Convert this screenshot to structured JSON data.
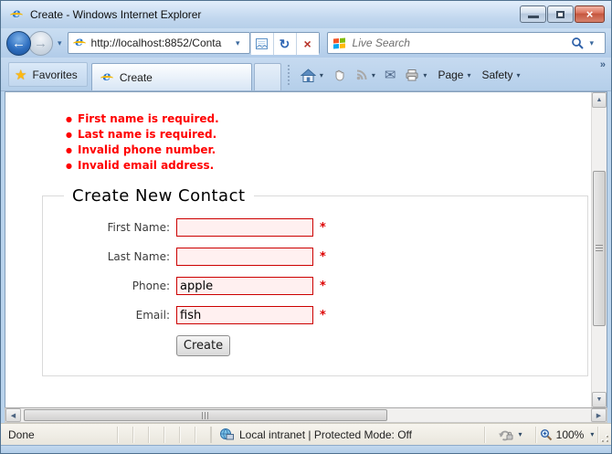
{
  "window": {
    "title": "Create - Windows Internet Explorer"
  },
  "titlebar_controls": {
    "minimize": "minimize",
    "maximize": "maximize",
    "close": "×"
  },
  "navbar": {
    "address_value": "http://localhost:8852/Conta",
    "search_placeholder": "Live Search"
  },
  "favorites_bar": {
    "favorites_label": "Favorites",
    "active_tab_title": "Create"
  },
  "command_bar": {
    "page_label": "Page",
    "safety_label": "Safety",
    "overflow": "»"
  },
  "page": {
    "validation_errors": [
      "First name is required.",
      "Last name is required.",
      "Invalid phone number.",
      "Invalid email address."
    ],
    "heading": "Create New Contact",
    "form": {
      "fields": [
        {
          "label": "First Name:",
          "value": "",
          "required_marker": "*"
        },
        {
          "label": "Last Name:",
          "value": "",
          "required_marker": "*"
        },
        {
          "label": "Phone:",
          "value": "apple",
          "required_marker": "*"
        },
        {
          "label": "Email:",
          "value": "fish",
          "required_marker": "*"
        }
      ],
      "submit_label": "Create"
    }
  },
  "status_bar": {
    "status_text": "Done",
    "zone_text": "Local intranet | Protected Mode: Off",
    "zoom_level": "100%"
  },
  "icons": {
    "ie_logo": "e",
    "back_arrow": "←",
    "forward_arrow": "→",
    "chevron_down": "▾",
    "refresh": "↻",
    "stop": "×",
    "favorites_star": "★",
    "mail": "✉",
    "scroll_up": "▲",
    "scroll_down": "▼",
    "scroll_left": "◀",
    "scroll_right": "▶"
  },
  "colors": {
    "error_text": "#ff0000",
    "invalid_input_border": "#cc0000",
    "invalid_input_bg": "#fff0f0",
    "required_marker": "#dd0000",
    "titlebar_blue": "#c3d8ef"
  }
}
